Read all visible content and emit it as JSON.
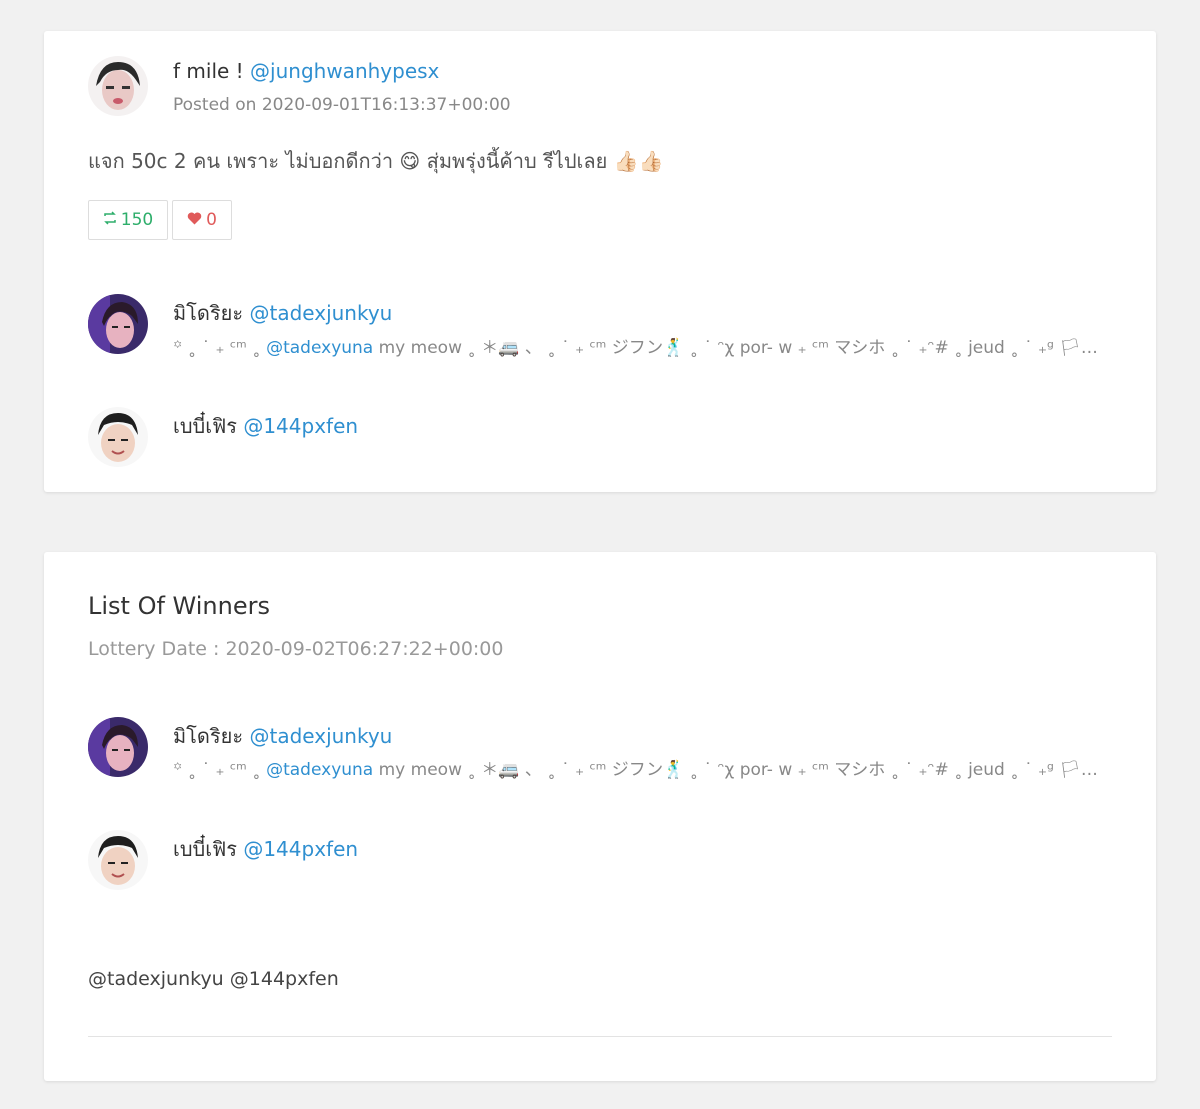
{
  "post": {
    "author_name": "f mile !",
    "author_handle": "@junghwanhypesx",
    "posted_prefix": "Posted on",
    "posted_time": "2020-09-01T16:13:37+00:00",
    "text": "แจก 50c 2 คน เพราะ ไม่บอกดีกว่า 😋 สุ่มพรุ่งนี้ค้าบ รีไปเลย 👍🏻👍🏻",
    "retweet_count": "150",
    "like_count": "0",
    "retweet_icon": "retweet-icon",
    "like_icon": "heart-icon"
  },
  "participants": [
    {
      "name": "มิโดริยะ",
      "handle": "@tadexjunkyu",
      "bio_prefix": "꙳ ˳ ˙ ₊ ᶜᵐ ˳",
      "bio_handle": "@tadexyuna",
      "bio_rest": "my meow ˳ ＊🚐 、 ˳ ˙ ₊ ᶜᵐ ジフン🕺 ˳ ˙ ᵔχ por- w ₊ ᶜᵐ マシホ ˳ ˙ ₊ᵔ# ˳ jeud ˳ ˙ ₊ᵍ 🏳ハルト ..."
    },
    {
      "name": "เบบี๋เฟิร",
      "handle": "@144pxfen"
    }
  ],
  "winners_section": {
    "title": "List Of Winners",
    "date_label": "Lottery Date : 2020-09-02T06:27:22+00:00",
    "winners": [
      {
        "name": "มิโดริยะ",
        "handle": "@tadexjunkyu",
        "bio_prefix": "꙳ ˳ ˙ ₊ ᶜᵐ ˳",
        "bio_handle": "@tadexyuna",
        "bio_rest": "my meow ˳ ＊🚐 、 ˳ ˙ ₊ ᶜᵐ ジフン🕺 ˳ ˙ ᵔχ por- w ₊ ᶜᵐ マシホ ˳ ˙ ₊ᵔ# ˳ jeud ˳ ˙ ₊ᵍ 🏳ハルト ..."
      },
      {
        "name": "เบบี๋เฟิร",
        "handle": "@144pxfen"
      }
    ],
    "mentions": "@tadexjunkyu @144pxfen"
  },
  "colors": {
    "link": "#2f8fd0",
    "retweet": "#2eae6b",
    "like": "#e05a5a",
    "background": "#f1f1f1"
  }
}
